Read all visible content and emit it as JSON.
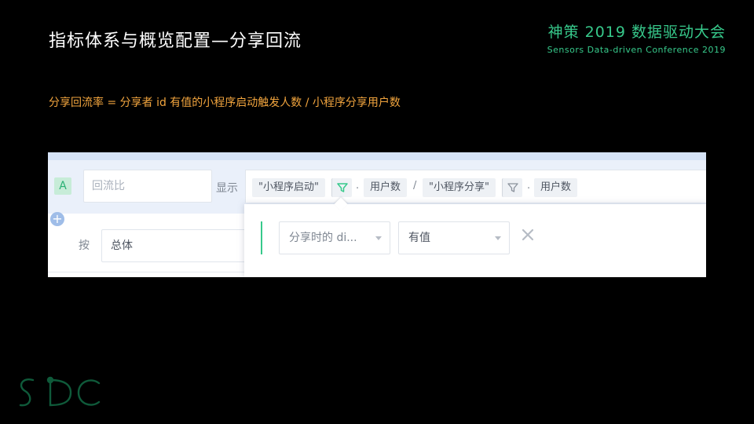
{
  "slide": {
    "title": "指标体系与概览配置—分享回流",
    "brand_title": "神策 2019 数据驱动大会",
    "brand_subtitle": "Sensors Data-driven Conference 2019",
    "formula": "分享回流率 = 分享者 id 有值的小程序启动触发人数 / 小程序分享用户数",
    "logo_text": "SDC"
  },
  "metric_row": {
    "badge": "A",
    "name_placeholder": "回流比",
    "display_label": "显示",
    "expression": {
      "event1": "\"小程序启动\"",
      "dot1": ".",
      "measure1": "用户数",
      "divide": "/",
      "event2": "\"小程序分享\"",
      "dot2": ".",
      "measure2": "用户数"
    },
    "add_button": "+"
  },
  "group_row": {
    "label": "按",
    "value": "总体"
  },
  "filter_popover": {
    "property_select": "分享时的 di...",
    "operator_select": "有值"
  },
  "colors": {
    "accent_green": "#37c98b",
    "formula_orange": "#f2a53e"
  },
  "icons": {
    "filter": "filter-funnel-icon",
    "close": "close-icon",
    "add": "plus-circle-icon"
  }
}
